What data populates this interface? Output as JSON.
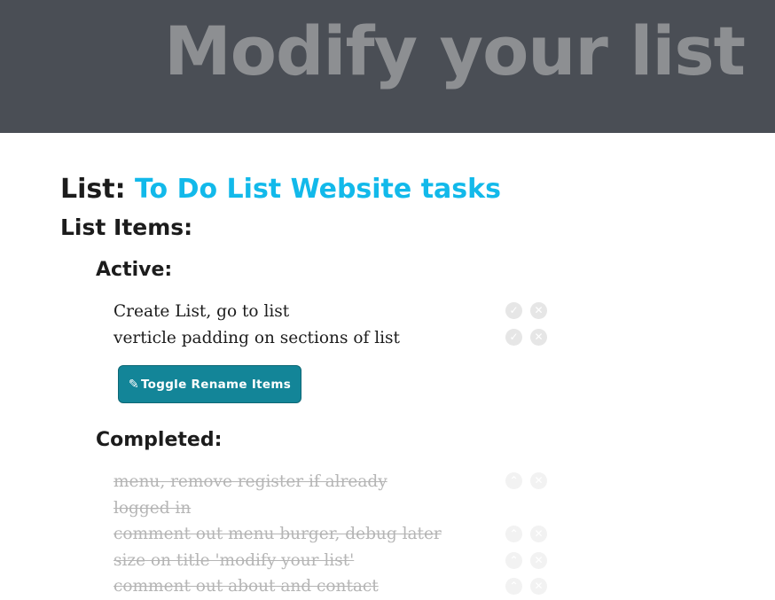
{
  "header": {
    "title": "Modify your list"
  },
  "list": {
    "label": "List:",
    "name": "To Do List Website tasks"
  },
  "items_heading": "List Items:",
  "active": {
    "heading": "Active:",
    "items": [
      {
        "text": "Create List, go to list"
      },
      {
        "text": "verticle padding on sections of list"
      }
    ]
  },
  "toggle_button": {
    "icon": "pencil-icon",
    "label": "Toggle Rename Items"
  },
  "completed": {
    "heading": "Completed:",
    "items": [
      {
        "text": "menu, remove register if already logged in"
      },
      {
        "text": "comment out menu burger, debug later"
      },
      {
        "text": "size on title 'modify your list'"
      },
      {
        "text": "comment out about and contact"
      }
    ]
  },
  "icons": {
    "complete": "check-icon",
    "delete": "close-icon",
    "restore": "chevron-up-icon"
  },
  "colors": {
    "header_bg": "#4a4e55",
    "accent": "#12b9ea",
    "button_bg": "#138598"
  }
}
